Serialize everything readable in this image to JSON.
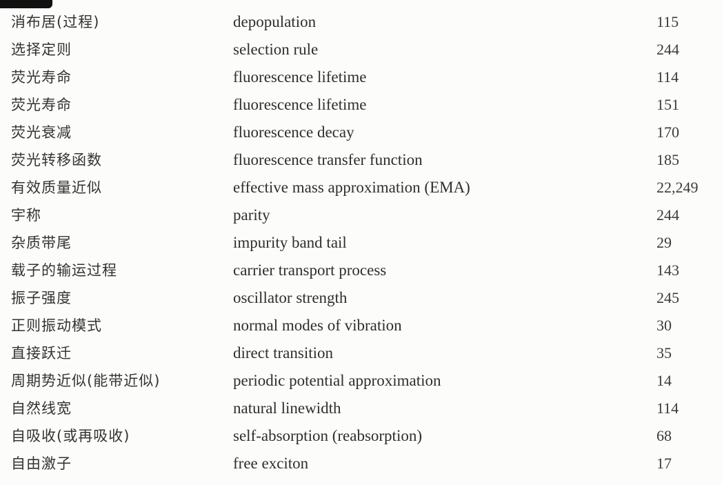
{
  "index": {
    "rows": [
      {
        "cn": "消布居(过程)",
        "en": "depopulation",
        "page": "115"
      },
      {
        "cn": "选择定则",
        "en": "selection rule",
        "page": "244"
      },
      {
        "cn": "荧光寿命",
        "en": "fluorescence lifetime",
        "page": "114"
      },
      {
        "cn": "荧光寿命",
        "en": "fluorescence lifetime",
        "page": "151"
      },
      {
        "cn": "荧光衰减",
        "en": "fluorescence decay",
        "page": "170"
      },
      {
        "cn": "荧光转移函数",
        "en": "fluorescence transfer function",
        "page": "185"
      },
      {
        "cn": "有效质量近似",
        "en": "effective mass approximation (EMA)",
        "page": "22,249"
      },
      {
        "cn": "宇称",
        "en": "parity",
        "page": "244"
      },
      {
        "cn": "杂质带尾",
        "en": "impurity band tail",
        "page": "29"
      },
      {
        "cn": "载子的输运过程",
        "en": "carrier transport process",
        "page": "143"
      },
      {
        "cn": "振子强度",
        "en": "oscillator strength",
        "page": "245"
      },
      {
        "cn": "正则振动模式",
        "en": "normal modes of vibration",
        "page": "30"
      },
      {
        "cn": "直接跃迁",
        "en": "direct transition",
        "page": "35"
      },
      {
        "cn": "周期势近似(能带近似)",
        "en": "periodic potential approximation",
        "page": "14"
      },
      {
        "cn": "自然线宽",
        "en": "natural linewidth",
        "page": "114"
      },
      {
        "cn": "自吸收(或再吸收)",
        "en": "self-absorption (reabsorption)",
        "page": "68"
      },
      {
        "cn": "自由激子",
        "en": "free exciton",
        "page": "17"
      }
    ]
  }
}
